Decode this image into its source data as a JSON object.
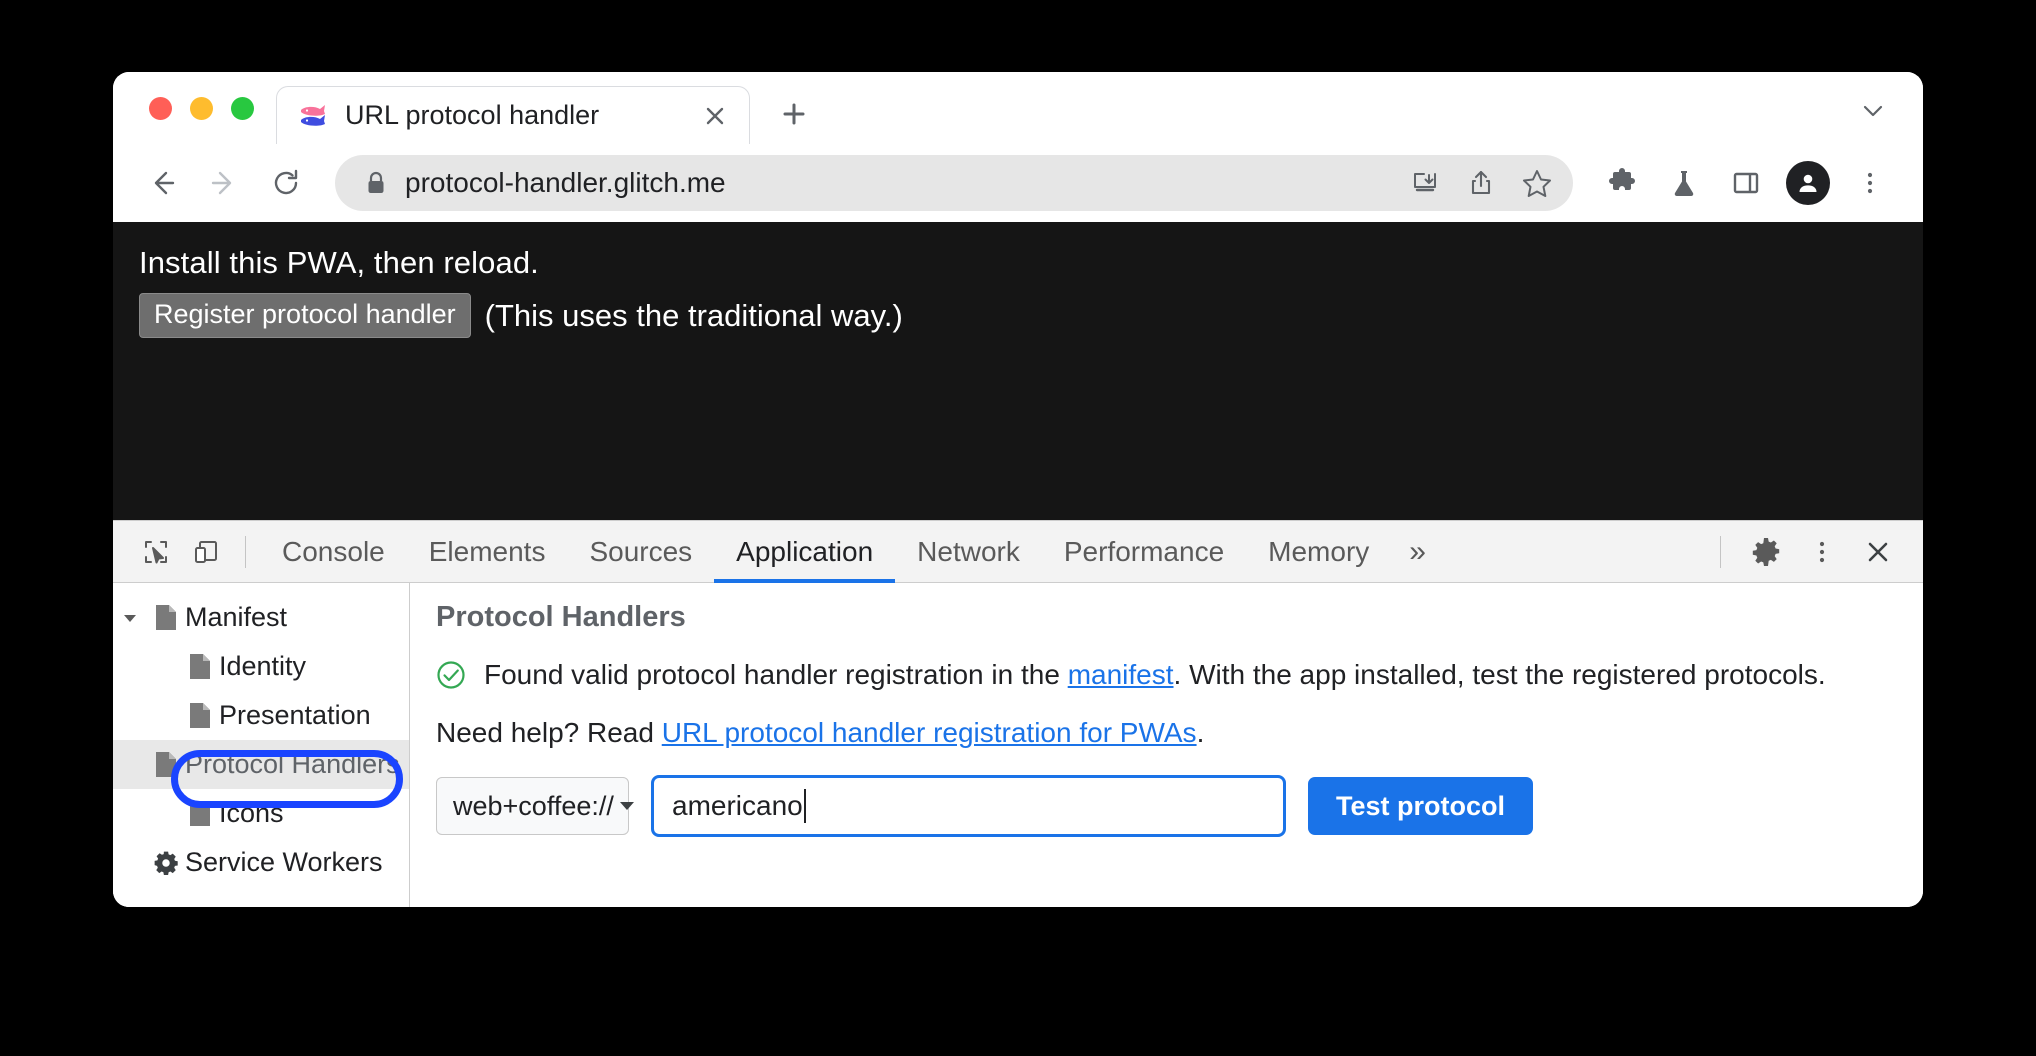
{
  "window": {
    "traffic_lights": [
      "close",
      "minimize",
      "maximize"
    ]
  },
  "tabstrip": {
    "tab": {
      "title": "URL protocol handler",
      "favicon": "glitch-fish-icon",
      "close_label": "✕"
    },
    "new_tab_label": "+",
    "tab_search_label": "∨"
  },
  "toolbar": {
    "back": "←",
    "forward": "→",
    "reload": "↻",
    "url": "protocol-handler.glitch.me",
    "lock_icon": "lock-icon",
    "omnibox_icons": [
      "install-pwa-icon",
      "share-icon",
      "bookmark-star-icon"
    ],
    "right_icons": [
      "extensions-puzzle-icon",
      "flask-icon",
      "side-panel-icon",
      "profile-avatar",
      "three-dot-menu-icon"
    ]
  },
  "page": {
    "headline": "Install this PWA, then reload.",
    "register_button": "Register protocol handler",
    "note": "(This uses the traditional way.)",
    "background": "#151515"
  },
  "devtools": {
    "tools": [
      "inspect-element-icon",
      "device-toolbar-icon"
    ],
    "tabs": [
      {
        "label": "Console",
        "active": false
      },
      {
        "label": "Elements",
        "active": false
      },
      {
        "label": "Sources",
        "active": false
      },
      {
        "label": "Application",
        "active": true
      },
      {
        "label": "Network",
        "active": false
      },
      {
        "label": "Performance",
        "active": false
      },
      {
        "label": "Memory",
        "active": false
      }
    ],
    "overflow_label": "»",
    "right_icons": [
      "settings-gear-icon",
      "more-options-icon",
      "close-devtools-icon"
    ],
    "accent_color": "#1a73e8",
    "sidebar": {
      "items": [
        {
          "label": "Manifest",
          "icon": "manifest-file-icon",
          "depth": 0,
          "expanded": true,
          "selected": false
        },
        {
          "label": "Identity",
          "icon": "file-icon",
          "depth": 1,
          "selected": false
        },
        {
          "label": "Presentation",
          "icon": "file-icon",
          "depth": 1,
          "selected": false
        },
        {
          "label": "Protocol Handlers",
          "icon": "file-icon",
          "depth": 1,
          "selected": true
        },
        {
          "label": "Icons",
          "icon": "file-icon",
          "depth": 1,
          "selected": false
        },
        {
          "label": "Service Workers",
          "icon": "gear-icon",
          "depth": 0,
          "selected": false
        }
      ],
      "highlight_color": "#1a44ff"
    },
    "panel": {
      "title": "Protocol Handlers",
      "status_icon": "green-check-circle-icon",
      "status_color": "#34a853",
      "message_before_link": "Found valid protocol handler registration in the ",
      "message_link": "manifest",
      "message_after_link": ". With the app installed, test the registered protocols.",
      "help_prefix": "Need help? Read ",
      "help_link": "URL protocol handler registration for PWAs",
      "help_suffix": ".",
      "form": {
        "scheme_value": "web+coffee://",
        "scheme_caret": "▼",
        "input_value": "americano",
        "input_placeholder": "",
        "test_button": "Test protocol"
      }
    }
  }
}
